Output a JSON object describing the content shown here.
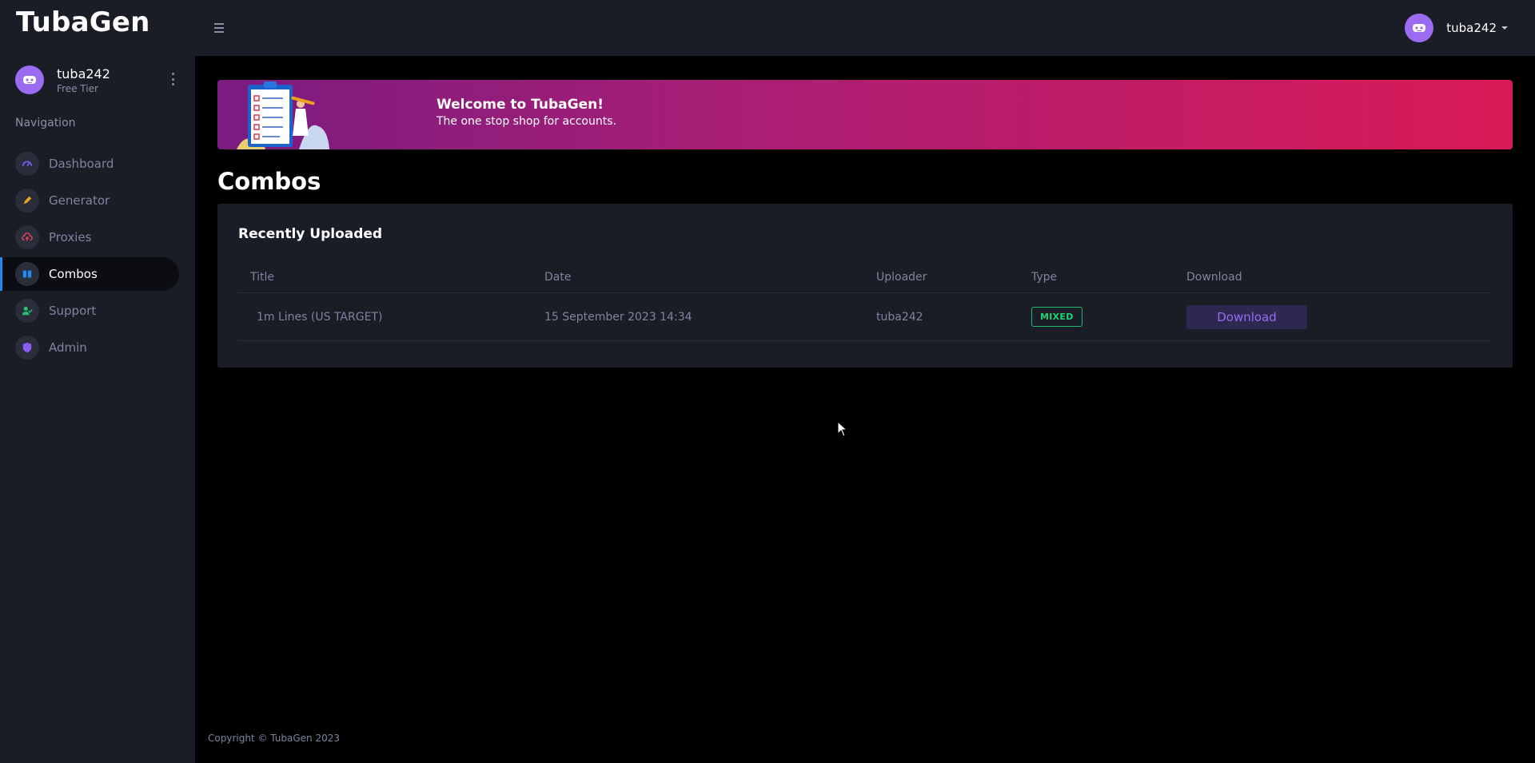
{
  "brand": "TubaGen",
  "topbar": {
    "username": "tuba242"
  },
  "sidebar": {
    "profile": {
      "name": "tuba242",
      "tier": "Free Tier"
    },
    "heading": "Navigation",
    "items": [
      {
        "label": "Dashboard",
        "icon": "dashboard-icon",
        "color": "#7b5cf0"
      },
      {
        "label": "Generator",
        "icon": "pencil-icon",
        "color": "#f0a020"
      },
      {
        "label": "Proxies",
        "icon": "cloud-upload-icon",
        "color": "#e0405a"
      },
      {
        "label": "Combos",
        "icon": "book-icon",
        "color": "#1e8bf0",
        "active": true
      },
      {
        "label": "Support",
        "icon": "user-check-icon",
        "color": "#20c070"
      },
      {
        "label": "Admin",
        "icon": "shield-icon",
        "color": "#8b5cf6"
      }
    ]
  },
  "banner": {
    "title": "Welcome to TubaGen!",
    "subtitle": "The one stop shop for accounts."
  },
  "page": {
    "title": "Combos"
  },
  "card": {
    "title": "Recently Uploaded",
    "columns": [
      "Title",
      "Date",
      "Uploader",
      "Type",
      "Download"
    ],
    "rows": [
      {
        "title": "1m Lines (US TARGET)",
        "date": "15 September 2023 14:34",
        "uploader": "tuba242",
        "type": "MIXED",
        "download": "Download"
      }
    ]
  },
  "footer": "Copyright © TubaGen 2023"
}
